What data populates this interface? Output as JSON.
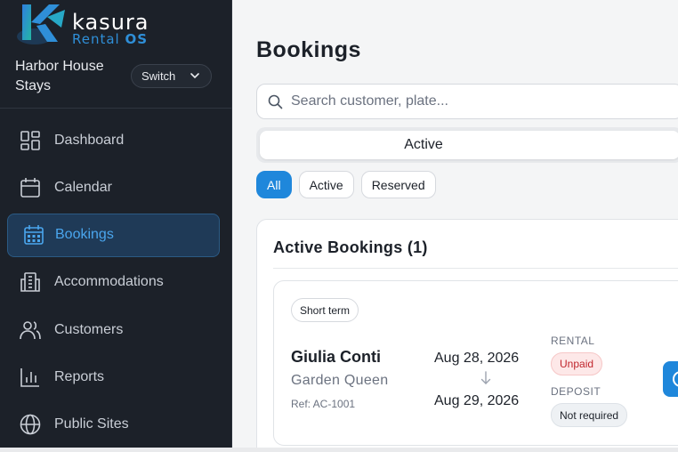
{
  "brand": {
    "name": "kasura",
    "sub_light": "Rental",
    "sub_bold": "OS"
  },
  "org": {
    "name": "Harbor House Stays",
    "switch_label": "Switch"
  },
  "nav": [
    {
      "label": "Dashboard",
      "icon": "dashboard-icon"
    },
    {
      "label": "Calendar",
      "icon": "calendar-icon"
    },
    {
      "label": "Bookings",
      "icon": "bookings-icon",
      "active": true
    },
    {
      "label": "Accommodations",
      "icon": "building-icon"
    },
    {
      "label": "Customers",
      "icon": "users-icon"
    },
    {
      "label": "Reports",
      "icon": "bar-chart-icon"
    },
    {
      "label": "Public Sites",
      "icon": "globe-icon"
    }
  ],
  "page": {
    "title": "Bookings"
  },
  "search": {
    "placeholder": "Search customer, plate..."
  },
  "segment": {
    "active_label": "Active"
  },
  "filters": {
    "all": "All",
    "active": "Active",
    "reserved": "Reserved"
  },
  "section": {
    "title": "Active Bookings (1)"
  },
  "booking": {
    "term": "Short term",
    "customer": "Giulia Conti",
    "vehicle": "Garden Queen",
    "ref": "Ref: AC-1001",
    "from": "Aug 28, 2026",
    "to": "Aug 29, 2026",
    "rental_label": "RENTAL",
    "rental_status": "Unpaid",
    "deposit_label": "DEPOSIT",
    "deposit_status": "Not required"
  },
  "colors": {
    "accent": "#1f87db",
    "sidebar_bg": "#1c2129",
    "danger": "#c0262d"
  }
}
